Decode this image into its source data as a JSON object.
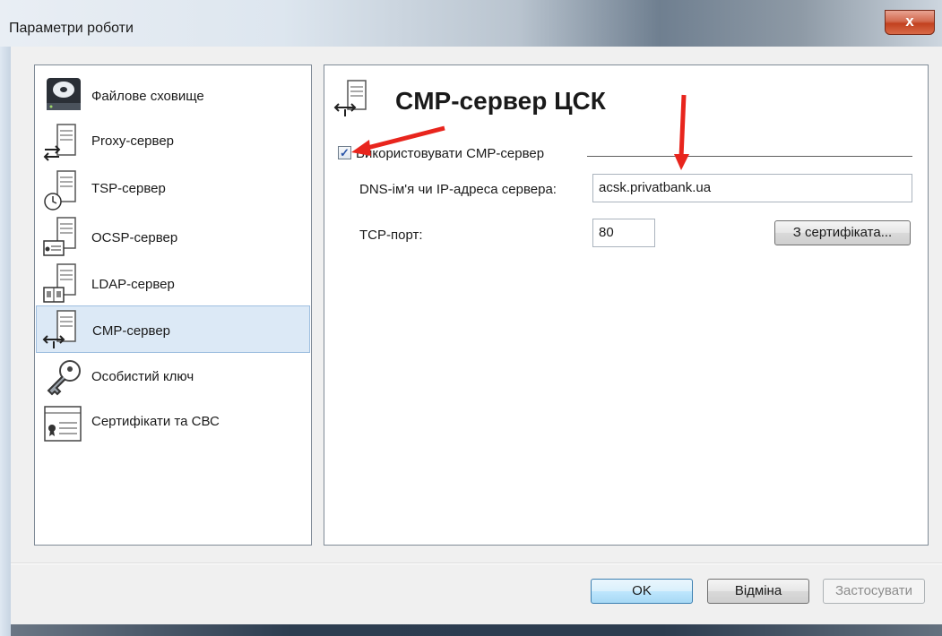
{
  "window": {
    "title": "Параметри роботи",
    "close_label": "x"
  },
  "sidebar": {
    "items": [
      {
        "label": "Файлове сховище",
        "icon": "disk-icon",
        "selected": false
      },
      {
        "label": "Proxy-сервер",
        "icon": "server-swap-icon",
        "selected": false
      },
      {
        "label": "TSP-сервер",
        "icon": "server-clock-icon",
        "selected": false
      },
      {
        "label": "OCSP-сервер",
        "icon": "server-certificate-icon",
        "selected": false
      },
      {
        "label": "LDAP-сервер",
        "icon": "server-directory-icon",
        "selected": false
      },
      {
        "label": "CMP-сервер",
        "icon": "server-arrows-icon",
        "selected": true
      },
      {
        "label": "Особистий ключ",
        "icon": "key-icon",
        "selected": false
      },
      {
        "label": "Сертифікати та СВС",
        "icon": "certificate-icon",
        "selected": false
      }
    ]
  },
  "main": {
    "heading": "CMP-сервер ЦСК",
    "heading_icon": "server-arrows-icon",
    "use_checkbox": {
      "label": "Використовувати CMP-сервер",
      "checked": true,
      "check_mark": "✓"
    },
    "dns_field": {
      "label": "DNS-ім'я чи IP-адреса сервера:",
      "value": "acsk.privatbank.ua"
    },
    "port_field": {
      "label": "TCP-порт:",
      "value": "80"
    },
    "from_cert_button": "З сертифіката..."
  },
  "footer": {
    "ok_label": "OK",
    "cancel_label": "Відміна",
    "apply_label": "Застосувати"
  },
  "colors": {
    "annotation_arrow": "#e8251d",
    "selection": "#dce9f6",
    "close_button": "#c2411f"
  }
}
